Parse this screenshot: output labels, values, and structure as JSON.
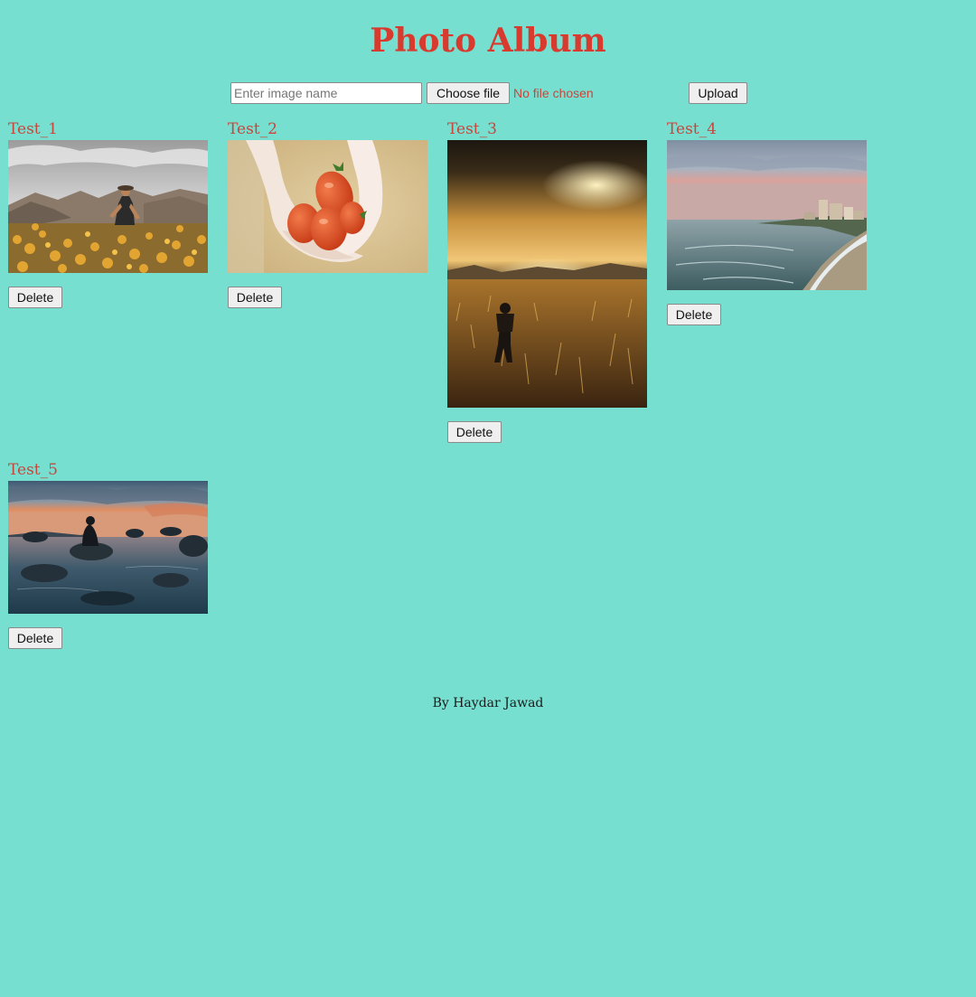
{
  "header": {
    "title": "Photo Album"
  },
  "upload_form": {
    "name_placeholder": "Enter image name",
    "choose_file_label": "Choose file",
    "file_status": "No file chosen",
    "upload_label": "Upload"
  },
  "photos": [
    {
      "name": "Test_1",
      "delete_label": "Delete",
      "scene": "woman-in-flower-field"
    },
    {
      "name": "Test_2",
      "delete_label": "Delete",
      "scene": "hands-holding-tomatoes"
    },
    {
      "name": "Test_3",
      "delete_label": "Delete",
      "scene": "person-in-golden-field"
    },
    {
      "name": "Test_4",
      "delete_label": "Delete",
      "scene": "coastline-sunset"
    },
    {
      "name": "Test_5",
      "delete_label": "Delete",
      "scene": "person-on-rock-lake"
    }
  ],
  "footer": {
    "credit": "By Haydar Jawad"
  },
  "colors": {
    "background": "#76dfd0",
    "accent": "#d83a2e",
    "label": "#c7473d"
  }
}
